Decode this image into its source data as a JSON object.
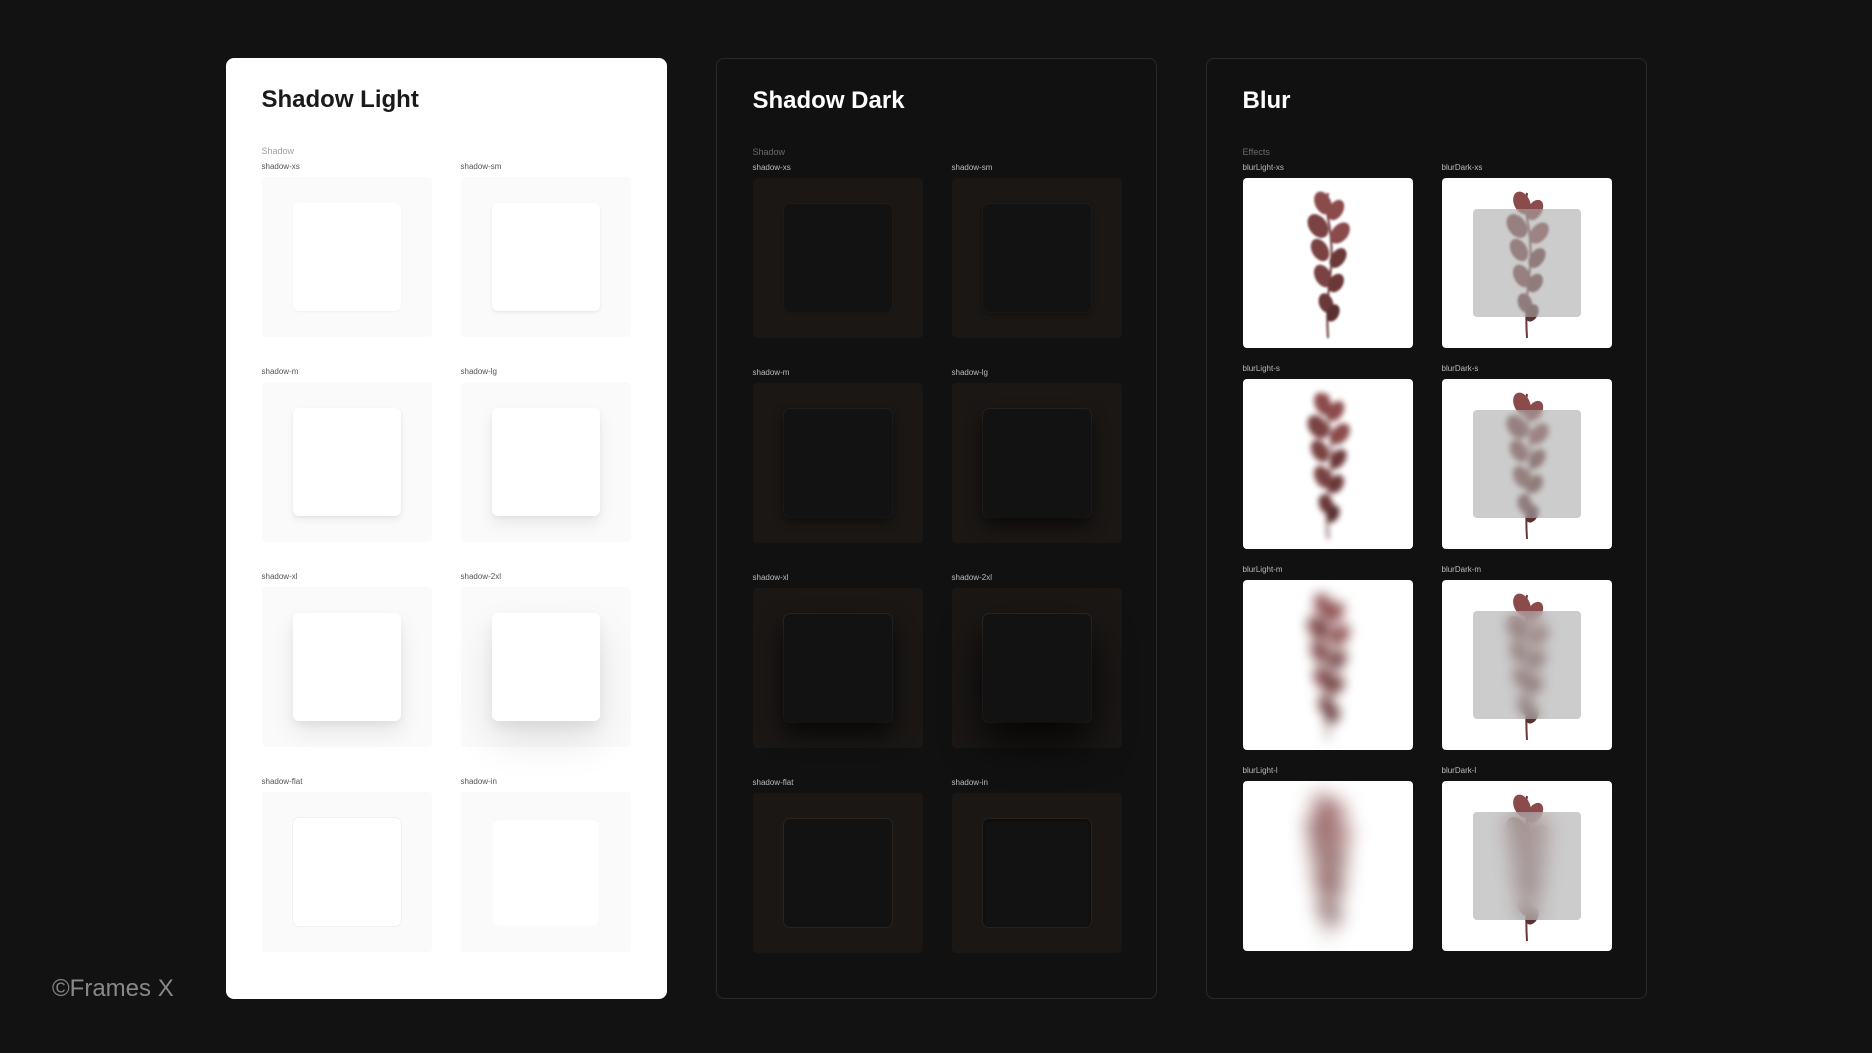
{
  "watermark": "©Frames X",
  "panels": {
    "light": {
      "title": "Shadow Light",
      "subheading": "Shadow",
      "samples": [
        "shadow-xs",
        "shadow-sm",
        "shadow-m",
        "shadow-lg",
        "shadow-xl",
        "shadow-2xl",
        "shadow-flat",
        "shadow-in"
      ]
    },
    "dark": {
      "title": "Shadow Dark",
      "subheading": "Shadow",
      "samples": [
        "shadow-xs",
        "shadow-sm",
        "shadow-m",
        "shadow-lg",
        "shadow-xl",
        "shadow-2xl",
        "shadow-flat",
        "shadow-in"
      ]
    },
    "blur": {
      "title": "Blur",
      "subheading": "Effects",
      "samples": [
        "blurLight-xs",
        "blurDark-xs",
        "blurLight-s",
        "blurDark-s",
        "blurLight-m",
        "blurDark-m",
        "blurLight-l",
        "blurDark-l"
      ]
    }
  }
}
